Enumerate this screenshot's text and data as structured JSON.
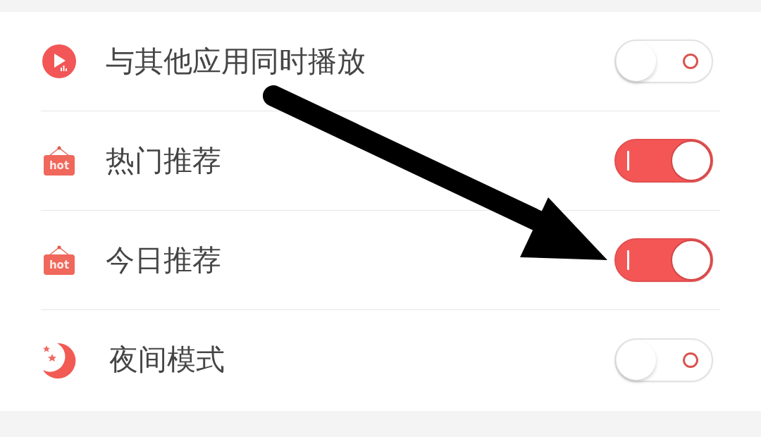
{
  "settings": [
    {
      "kind": "media",
      "label": "与其他应用同时播放",
      "on": false
    },
    {
      "kind": "hot",
      "badge": "hot",
      "label": "热门推荐",
      "on": true
    },
    {
      "kind": "hot",
      "badge": "hot",
      "label": "今日推荐",
      "on": true
    },
    {
      "kind": "night",
      "label": "夜间模式",
      "on": false
    }
  ]
}
